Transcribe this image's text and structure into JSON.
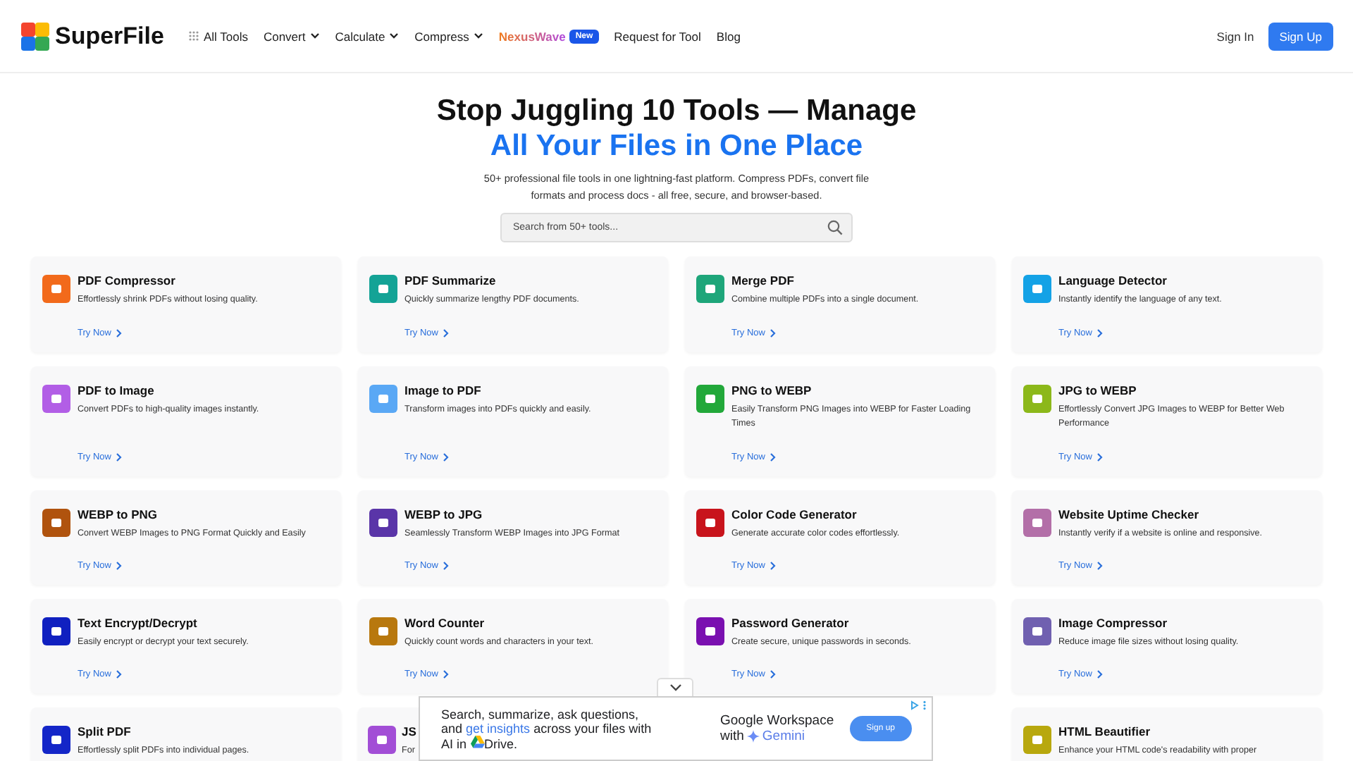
{
  "header": {
    "logo": "SuperFile",
    "nav": [
      {
        "label": "All Tools",
        "kind": "grid"
      },
      {
        "label": "Convert",
        "kind": "dropdown"
      },
      {
        "label": "Calculate",
        "kind": "dropdown"
      },
      {
        "label": "Compress",
        "kind": "dropdown"
      },
      {
        "label": "NexusWave",
        "kind": "featured",
        "badge": "New"
      },
      {
        "label": "Request for Tool",
        "kind": "plain"
      },
      {
        "label": "Blog",
        "kind": "plain"
      }
    ],
    "sign_in": "Sign In",
    "sign_up": "Sign Up"
  },
  "hero": {
    "title": "Stop Juggling 10 Tools — Manage",
    "highlight": "All Your Files in One Place",
    "subtitle": "50+ professional file tools in one lightning-fast platform. Compress PDFs, convert file formats and process docs - all free, secure, and browser-based.",
    "search": {
      "placeholder": "Search from 50+ tools..."
    }
  },
  "tools": [
    {
      "kind": "card",
      "title": "PDF Compressor",
      "description": "Effortlessly shrink PDFs without losing quality.",
      "link": "Try Now",
      "color": "#f26a1b"
    },
    {
      "kind": "card",
      "title": "PDF Summarize",
      "description": "Quickly summarize lengthy PDF documents.",
      "link": "Try Now",
      "color": "#14a396"
    },
    {
      "kind": "card",
      "title": "Merge PDF",
      "description": "Combine multiple PDFs into a single document.",
      "link": "Try Now",
      "color": "#1ea67a"
    },
    {
      "kind": "card",
      "title": "Language Detector",
      "description": "Instantly identify the language of any text.",
      "link": "Try Now",
      "color": "#14a2e6"
    },
    {
      "kind": "card",
      "title": "PDF to Image",
      "description": "Convert PDFs to high-quality images instantly.",
      "link": "Try Now",
      "color": "#b25ee6"
    },
    {
      "kind": "card",
      "title": "Image to PDF",
      "description": "Transform images into PDFs quickly and easily.",
      "link": "Try Now",
      "color": "#5aa8f5"
    },
    {
      "kind": "card",
      "title": "PNG to WEBP",
      "description": "Easily Transform PNG Images into WEBP for Faster Loading Times",
      "link": "Try Now",
      "color": "#22a83a"
    },
    {
      "kind": "card",
      "title": "JPG to WEBP",
      "description": "Effortlessly Convert JPG Images to WEBP for Better Web Performance",
      "link": "Try Now",
      "color": "#8cb81a"
    },
    {
      "kind": "card",
      "title": "WEBP to PNG",
      "description": "Convert WEBP Images to PNG Format Quickly and Easily",
      "link": "Try Now",
      "color": "#b0530e"
    },
    {
      "kind": "card",
      "title": "WEBP to JPG",
      "description": "Seamlessly Transform WEBP Images into JPG Format",
      "link": "Try Now",
      "color": "#5a35a8"
    },
    {
      "kind": "card",
      "title": "Color Code Generator",
      "description": "Generate accurate color codes effortlessly.",
      "link": "Try Now",
      "color": "#c8141c"
    },
    {
      "kind": "card",
      "title": "Website Uptime Checker",
      "description": "Instantly verify if a website is online and responsive.",
      "link": "Try Now",
      "color": "#b36fa8"
    },
    {
      "kind": "card",
      "title": "Text Encrypt/Decrypt",
      "description": "Easily encrypt or decrypt your text securely.",
      "link": "Try Now",
      "color": "#1020c0"
    },
    {
      "kind": "card",
      "title": "Word Counter",
      "description": "Quickly count words and characters in your text.",
      "link": "Try Now",
      "color": "#b8780e"
    },
    {
      "kind": "card",
      "title": "Password Generator",
      "description": "Create secure, unique passwords in seconds.",
      "link": "Try Now",
      "color": "#7a10b0"
    },
    {
      "kind": "card",
      "title": "Image Compressor",
      "description": "Reduce image file sizes without losing quality.",
      "link": "Try Now",
      "color": "#7060b0"
    },
    {
      "kind": "card",
      "title": "Split PDF",
      "description": "Effortlessly split PDFs into individual pages.",
      "color": "#1426c8"
    },
    {
      "kind": "partial",
      "title": "JS",
      "description": "For",
      "color": "#a24ed6"
    },
    {
      "kind": "card",
      "title": "HTML Beautifier",
      "description": "Enhance your HTML code's readability with proper",
      "color": "#b8a80e"
    }
  ],
  "ad": {
    "headline": [
      {
        "text": "Search, summarize, ask questions, and ",
        "kind": "plain"
      },
      {
        "text": "get insights",
        "kind": "link"
      },
      {
        "text": " across your files with AI in ",
        "kind": "plain"
      },
      {
        "text": "Drive.",
        "kind": "drive"
      }
    ],
    "brand": "Google Workspace",
    "brand_with": "with",
    "brand_product": "Gemini",
    "button": "Sign up"
  }
}
